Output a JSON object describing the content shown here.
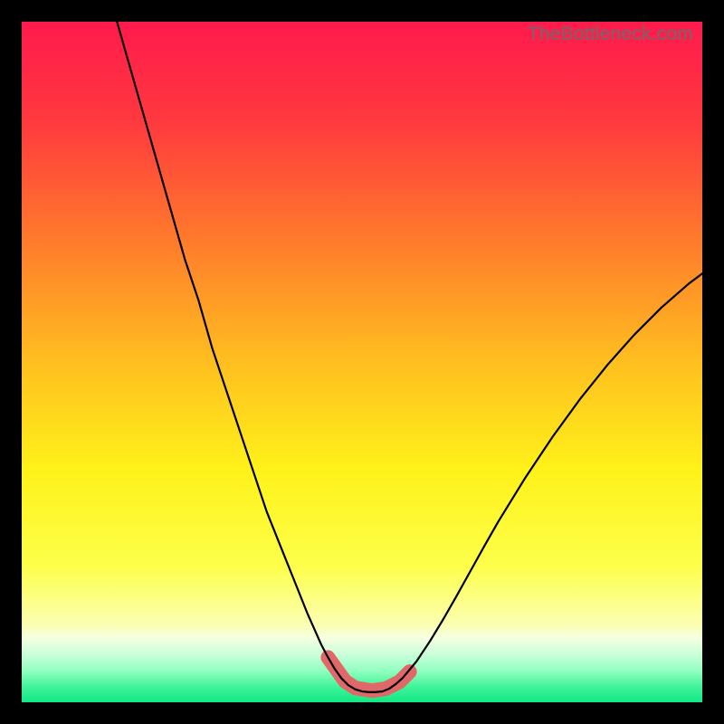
{
  "watermark": "TheBottleneck.com",
  "chart_data": {
    "type": "line",
    "title": "",
    "xlabel": "",
    "ylabel": "",
    "xlim": [
      0,
      100
    ],
    "ylim": [
      0,
      100
    ],
    "grid": false,
    "series": [
      {
        "name": "curve",
        "x": [
          14,
          16,
          18,
          20,
          22,
          24,
          26,
          28,
          30,
          32,
          34,
          36,
          38,
          40,
          42,
          44,
          45,
          46,
          47,
          48,
          49,
          50,
          51,
          52,
          53,
          54,
          55,
          56,
          58,
          60,
          62,
          64,
          66,
          68,
          70,
          74,
          78,
          82,
          86,
          90,
          94,
          98,
          100
        ],
        "y": [
          100,
          93,
          86,
          79,
          72,
          65,
          59,
          52,
          46,
          40,
          34,
          28,
          23,
          18,
          13,
          8.5,
          6.6,
          4.9,
          3.5,
          2.5,
          1.9,
          1.6,
          1.5,
          1.5,
          1.6,
          2.0,
          2.7,
          3.6,
          6.0,
          9.0,
          12.3,
          15.8,
          19.4,
          23.0,
          26.5,
          33.0,
          39.0,
          44.5,
          49.5,
          54.0,
          58.0,
          61.5,
          63.0
        ]
      }
    ],
    "markers": [
      {
        "x": 45.0,
        "y": 6.6
      },
      {
        "x": 47.5,
        "y": 3.1
      },
      {
        "x": 49.0,
        "y": 2.1
      },
      {
        "x": 51.5,
        "y": 1.7
      },
      {
        "x": 53.5,
        "y": 2.0
      },
      {
        "x": 55.5,
        "y": 3.0
      },
      {
        "x": 57.0,
        "y": 4.5
      }
    ],
    "gradient_stops": [
      {
        "offset": 0.0,
        "color": "#ff1a4d"
      },
      {
        "offset": 0.15,
        "color": "#ff3a3e"
      },
      {
        "offset": 0.32,
        "color": "#ff7a2c"
      },
      {
        "offset": 0.5,
        "color": "#ffbf1f"
      },
      {
        "offset": 0.66,
        "color": "#fff21a"
      },
      {
        "offset": 0.8,
        "color": "#fdff4a"
      },
      {
        "offset": 0.885,
        "color": "#fbffb0"
      },
      {
        "offset": 0.905,
        "color": "#f6ffe0"
      },
      {
        "offset": 0.93,
        "color": "#c9ffda"
      },
      {
        "offset": 0.955,
        "color": "#8effbe"
      },
      {
        "offset": 0.975,
        "color": "#46f59d"
      },
      {
        "offset": 1.0,
        "color": "#10e884"
      }
    ],
    "marker_style": {
      "stroke": "#e06868",
      "stroke_width": 16,
      "linecap": "round"
    },
    "curve_style": {
      "stroke": "#000000",
      "stroke_width": 2.2
    }
  }
}
